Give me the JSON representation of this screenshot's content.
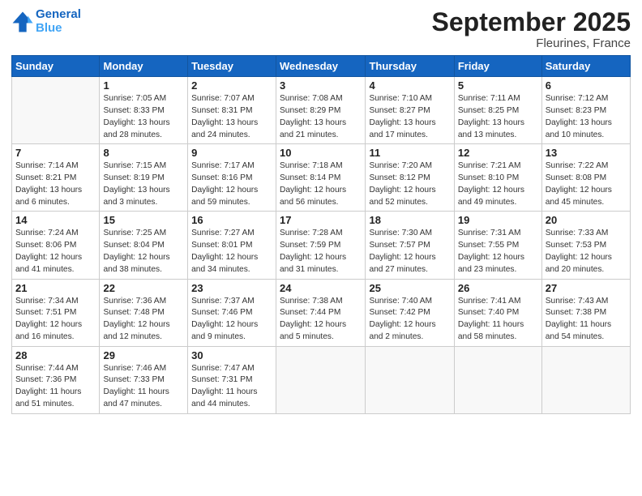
{
  "header": {
    "logo_line1": "General",
    "logo_line2": "Blue",
    "month_title": "September 2025",
    "location": "Fleurines, France"
  },
  "days_of_week": [
    "Sunday",
    "Monday",
    "Tuesday",
    "Wednesday",
    "Thursday",
    "Friday",
    "Saturday"
  ],
  "weeks": [
    [
      {
        "num": "",
        "info": ""
      },
      {
        "num": "1",
        "info": "Sunrise: 7:05 AM\nSunset: 8:33 PM\nDaylight: 13 hours\nand 28 minutes."
      },
      {
        "num": "2",
        "info": "Sunrise: 7:07 AM\nSunset: 8:31 PM\nDaylight: 13 hours\nand 24 minutes."
      },
      {
        "num": "3",
        "info": "Sunrise: 7:08 AM\nSunset: 8:29 PM\nDaylight: 13 hours\nand 21 minutes."
      },
      {
        "num": "4",
        "info": "Sunrise: 7:10 AM\nSunset: 8:27 PM\nDaylight: 13 hours\nand 17 minutes."
      },
      {
        "num": "5",
        "info": "Sunrise: 7:11 AM\nSunset: 8:25 PM\nDaylight: 13 hours\nand 13 minutes."
      },
      {
        "num": "6",
        "info": "Sunrise: 7:12 AM\nSunset: 8:23 PM\nDaylight: 13 hours\nand 10 minutes."
      }
    ],
    [
      {
        "num": "7",
        "info": "Sunrise: 7:14 AM\nSunset: 8:21 PM\nDaylight: 13 hours\nand 6 minutes."
      },
      {
        "num": "8",
        "info": "Sunrise: 7:15 AM\nSunset: 8:19 PM\nDaylight: 13 hours\nand 3 minutes."
      },
      {
        "num": "9",
        "info": "Sunrise: 7:17 AM\nSunset: 8:16 PM\nDaylight: 12 hours\nand 59 minutes."
      },
      {
        "num": "10",
        "info": "Sunrise: 7:18 AM\nSunset: 8:14 PM\nDaylight: 12 hours\nand 56 minutes."
      },
      {
        "num": "11",
        "info": "Sunrise: 7:20 AM\nSunset: 8:12 PM\nDaylight: 12 hours\nand 52 minutes."
      },
      {
        "num": "12",
        "info": "Sunrise: 7:21 AM\nSunset: 8:10 PM\nDaylight: 12 hours\nand 49 minutes."
      },
      {
        "num": "13",
        "info": "Sunrise: 7:22 AM\nSunset: 8:08 PM\nDaylight: 12 hours\nand 45 minutes."
      }
    ],
    [
      {
        "num": "14",
        "info": "Sunrise: 7:24 AM\nSunset: 8:06 PM\nDaylight: 12 hours\nand 41 minutes."
      },
      {
        "num": "15",
        "info": "Sunrise: 7:25 AM\nSunset: 8:04 PM\nDaylight: 12 hours\nand 38 minutes."
      },
      {
        "num": "16",
        "info": "Sunrise: 7:27 AM\nSunset: 8:01 PM\nDaylight: 12 hours\nand 34 minutes."
      },
      {
        "num": "17",
        "info": "Sunrise: 7:28 AM\nSunset: 7:59 PM\nDaylight: 12 hours\nand 31 minutes."
      },
      {
        "num": "18",
        "info": "Sunrise: 7:30 AM\nSunset: 7:57 PM\nDaylight: 12 hours\nand 27 minutes."
      },
      {
        "num": "19",
        "info": "Sunrise: 7:31 AM\nSunset: 7:55 PM\nDaylight: 12 hours\nand 23 minutes."
      },
      {
        "num": "20",
        "info": "Sunrise: 7:33 AM\nSunset: 7:53 PM\nDaylight: 12 hours\nand 20 minutes."
      }
    ],
    [
      {
        "num": "21",
        "info": "Sunrise: 7:34 AM\nSunset: 7:51 PM\nDaylight: 12 hours\nand 16 minutes."
      },
      {
        "num": "22",
        "info": "Sunrise: 7:36 AM\nSunset: 7:48 PM\nDaylight: 12 hours\nand 12 minutes."
      },
      {
        "num": "23",
        "info": "Sunrise: 7:37 AM\nSunset: 7:46 PM\nDaylight: 12 hours\nand 9 minutes."
      },
      {
        "num": "24",
        "info": "Sunrise: 7:38 AM\nSunset: 7:44 PM\nDaylight: 12 hours\nand 5 minutes."
      },
      {
        "num": "25",
        "info": "Sunrise: 7:40 AM\nSunset: 7:42 PM\nDaylight: 12 hours\nand 2 minutes."
      },
      {
        "num": "26",
        "info": "Sunrise: 7:41 AM\nSunset: 7:40 PM\nDaylight: 11 hours\nand 58 minutes."
      },
      {
        "num": "27",
        "info": "Sunrise: 7:43 AM\nSunset: 7:38 PM\nDaylight: 11 hours\nand 54 minutes."
      }
    ],
    [
      {
        "num": "28",
        "info": "Sunrise: 7:44 AM\nSunset: 7:36 PM\nDaylight: 11 hours\nand 51 minutes."
      },
      {
        "num": "29",
        "info": "Sunrise: 7:46 AM\nSunset: 7:33 PM\nDaylight: 11 hours\nand 47 minutes."
      },
      {
        "num": "30",
        "info": "Sunrise: 7:47 AM\nSunset: 7:31 PM\nDaylight: 11 hours\nand 44 minutes."
      },
      {
        "num": "",
        "info": ""
      },
      {
        "num": "",
        "info": ""
      },
      {
        "num": "",
        "info": ""
      },
      {
        "num": "",
        "info": ""
      }
    ]
  ]
}
